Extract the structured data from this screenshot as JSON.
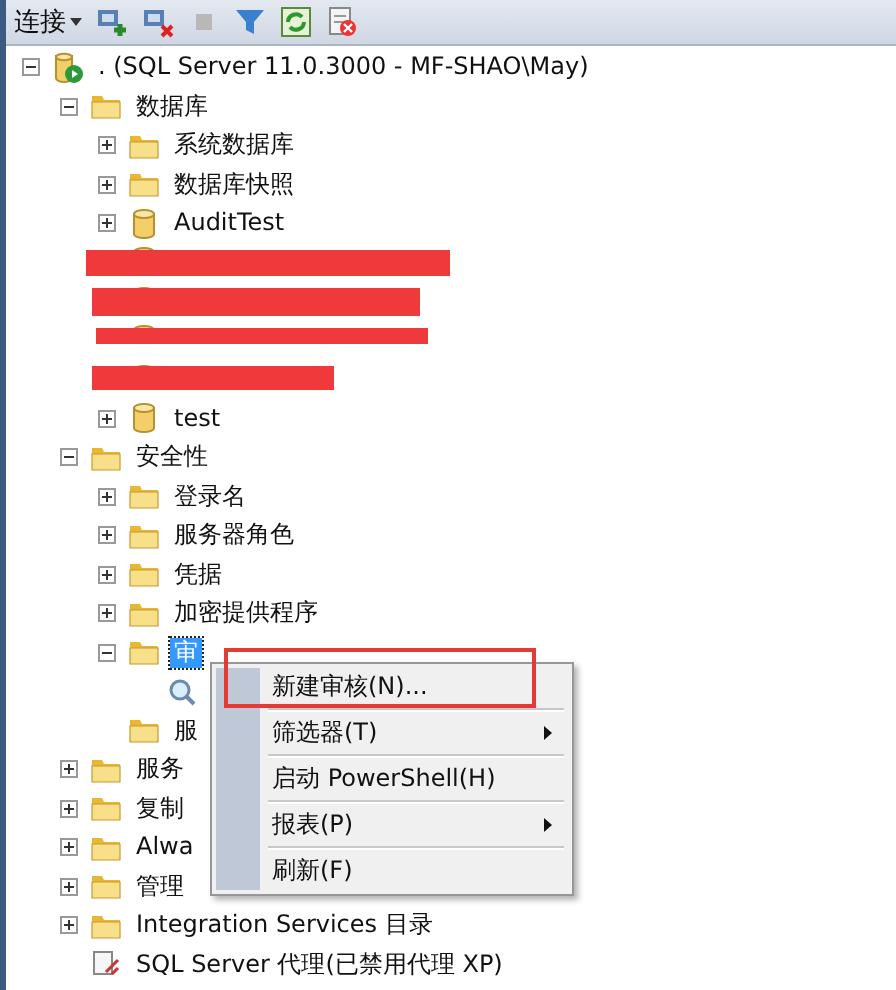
{
  "toolbar": {
    "connect_label": "连接",
    "tools": [
      {
        "kind": "connect"
      },
      {
        "kind": "disconnect"
      },
      {
        "kind": "stop",
        "disabled": true
      },
      {
        "kind": "filter"
      },
      {
        "kind": "refresh"
      },
      {
        "kind": "summary"
      }
    ]
  },
  "tree": [
    {
      "kind": "server",
      "label": ". (SQL Server 11.0.3000 - MF-SHAO\\May)",
      "expanded": true,
      "selected": false,
      "children": [
        {
          "kind": "folder",
          "label": "数据库",
          "expanded": true,
          "selected": false,
          "children": [
            {
              "kind": "folder",
              "label": "系统数据库",
              "expanded": false,
              "selected": false
            },
            {
              "kind": "folder",
              "label": "数据库快照",
              "expanded": false,
              "selected": false
            },
            {
              "kind": "database",
              "label": "AuditTest",
              "expanded": false,
              "selected": false
            },
            {
              "kind": "redacted"
            },
            {
              "kind": "redacted"
            },
            {
              "kind": "redacted"
            },
            {
              "kind": "redacted"
            },
            {
              "kind": "database",
              "label": "test",
              "expanded": false,
              "selected": false
            }
          ]
        },
        {
          "kind": "folder",
          "label": "安全性",
          "expanded": true,
          "selected": false,
          "children": [
            {
              "kind": "folder",
              "label": "登录名",
              "expanded": false,
              "selected": false
            },
            {
              "kind": "folder",
              "label": "服务器角色",
              "expanded": false,
              "selected": false
            },
            {
              "kind": "folder",
              "label": "凭据",
              "expanded": false,
              "selected": false
            },
            {
              "kind": "folder",
              "label": "加密提供程序",
              "expanded": false,
              "selected": false
            },
            {
              "kind": "folder",
              "label": "审",
              "expanded": true,
              "selected": true,
              "children": [
                {
                  "kind": "search"
                }
              ]
            },
            {
              "kind": "folder",
              "label": "服",
              "selected": false
            }
          ]
        },
        {
          "kind": "folder",
          "label": "服务",
          "expanded": false,
          "selected": false
        },
        {
          "kind": "folder",
          "label": "复制",
          "expanded": false,
          "selected": false
        },
        {
          "kind": "folder",
          "label": "Alwa",
          "expanded": false,
          "selected": false
        },
        {
          "kind": "folder",
          "label": "管理",
          "expanded": false,
          "selected": false
        },
        {
          "kind": "folder",
          "label": "Integration Services 目录",
          "expanded": false,
          "selected": false
        },
        {
          "kind": "agent",
          "label": "SQL Server 代理(已禁用代理 XP)",
          "selected": false
        }
      ]
    }
  ],
  "context_menu": [
    {
      "label": "新建审核(N)...",
      "submenu": false,
      "annotated": true
    },
    {
      "label": "筛选器(T)",
      "submenu": true,
      "annotated": false
    },
    {
      "label": "启动 PowerShell(H)",
      "submenu": false,
      "annotated": false
    },
    {
      "label": "报表(P)",
      "submenu": true,
      "annotated": false
    },
    {
      "label": "刷新(F)",
      "submenu": false,
      "annotated": false
    }
  ]
}
